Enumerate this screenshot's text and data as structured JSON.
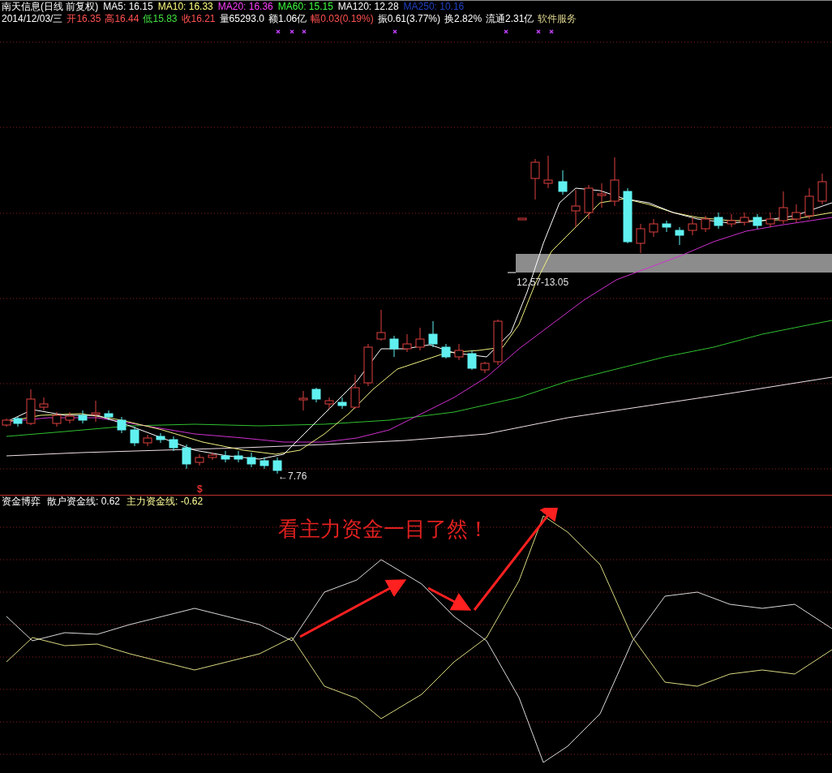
{
  "header": {
    "title": "南天信息(日线 前复权)",
    "ma": [
      {
        "label": "MA5: 16.15",
        "color": "#ffffff"
      },
      {
        "label": "MA10: 16.33",
        "color": "#ffff80"
      },
      {
        "label": "MA20: 16.36",
        "color": "#ff40ff"
      },
      {
        "label": "MA60: 15.15",
        "color": "#40ff40"
      },
      {
        "label": "MA120: 12.28",
        "color": "#ffffff"
      },
      {
        "label": "MA250: 10.16",
        "color": "#2040c0"
      }
    ]
  },
  "quote": {
    "date": "2014/12/03/三",
    "items": [
      {
        "text": "开16.35",
        "color": "#ff5050"
      },
      {
        "text": "高16.44",
        "color": "#ff5050"
      },
      {
        "text": "低15.83",
        "color": "#40e040"
      },
      {
        "text": "收16.21",
        "color": "#ff5050"
      },
      {
        "text": "量65293.0",
        "color": "#ffffff"
      },
      {
        "text": "额1.06亿",
        "color": "#ffffff"
      },
      {
        "text": "幅0.03(0.19%)",
        "color": "#ff5050"
      },
      {
        "text": "振0.61(3.77%)",
        "color": "#ffffff"
      },
      {
        "text": "换2.82%",
        "color": "#ffffff"
      },
      {
        "text": "流通2.31亿",
        "color": "#ffffff"
      }
    ],
    "sector": "软件服务"
  },
  "price_chart": {
    "range_label": "12.57-13.05",
    "low_label": "←7.76",
    "signal_mark": "$"
  },
  "indicator": {
    "title": "资金博弈",
    "lines": [
      {
        "label": "散户资金线: 0.62",
        "color": "#ffffff"
      },
      {
        "label": "主力资金线: -0.62",
        "color": "#ffff99"
      }
    ],
    "annotation": "看主力资金一目了然！"
  }
}
